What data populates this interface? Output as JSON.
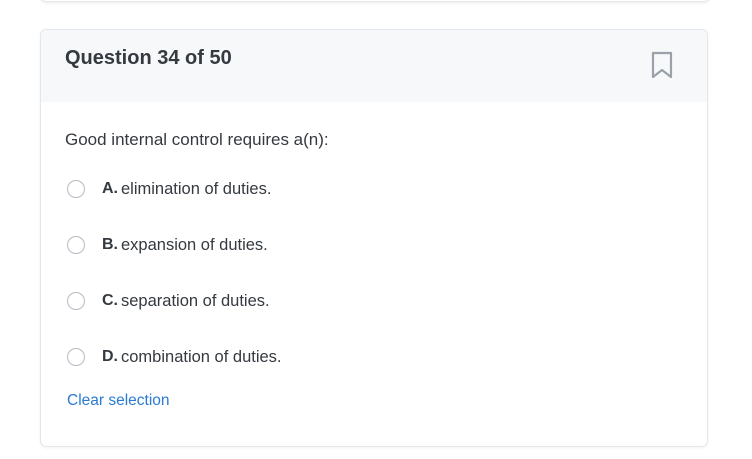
{
  "question": {
    "title": "Question 34 of 50",
    "text": "Good internal control requires a(n):",
    "options": [
      {
        "letter": "A.",
        "text": "elimination of duties."
      },
      {
        "letter": "B.",
        "text": "expansion of duties."
      },
      {
        "letter": "C.",
        "text": "separation of duties."
      },
      {
        "letter": "D.",
        "text": "combination of duties."
      }
    ],
    "clear_label": "Clear selection",
    "bookmark_icon": "bookmark-icon"
  },
  "colors": {
    "header_bg": "#f7f8f9",
    "link": "#2a7ad3",
    "text": "#343a40",
    "radio_border": "#b5bbc2"
  }
}
